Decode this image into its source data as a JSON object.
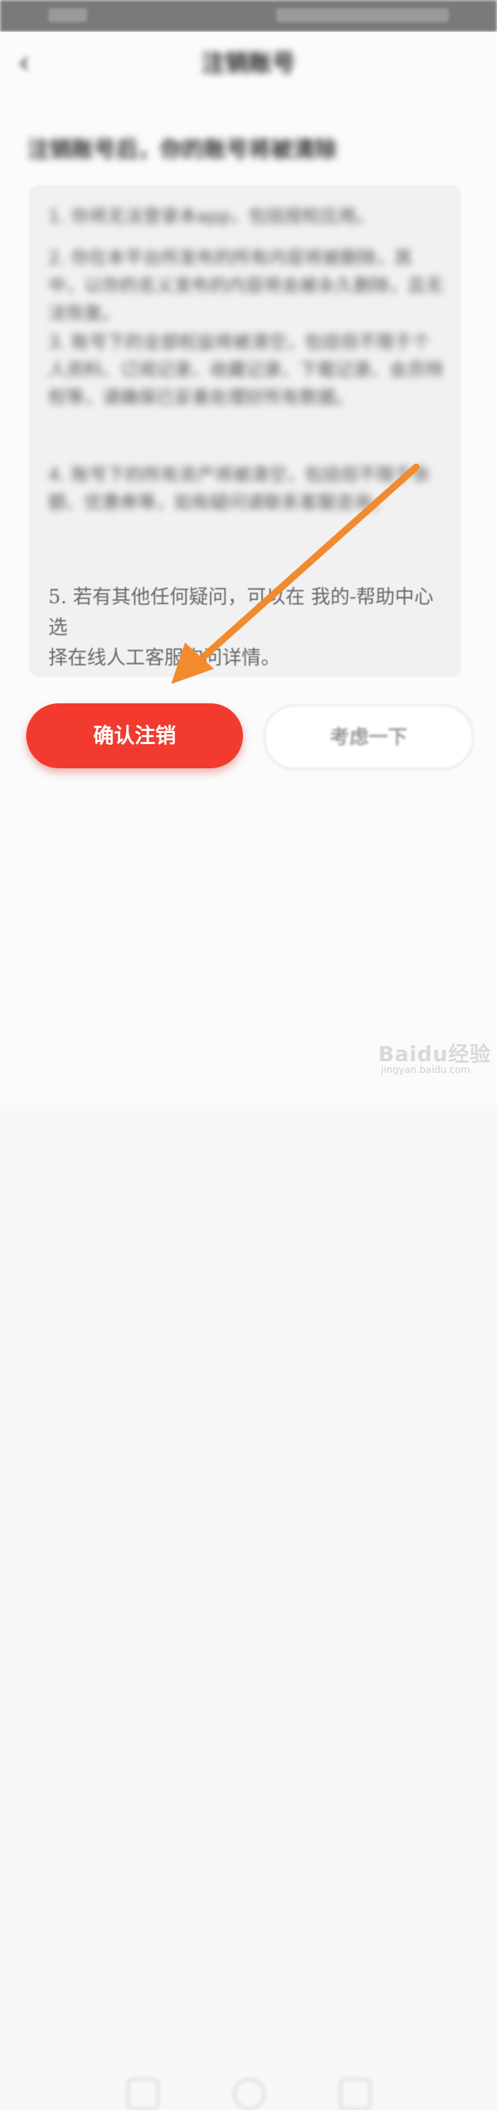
{
  "status_bar": {},
  "header": {
    "back_icon": "chevron-left-icon",
    "title": "注销账号"
  },
  "subtitle": "注销账号后，你的账号将被清除",
  "terms": {
    "item1": "1. 你将无法登录本app，包括授权应用。",
    "item2": "2. 你在本平台所发布的所有内容将被删除，其中，以你的名义发布的内容将会被永久删除，且无法恢复。",
    "item3": "3. 账号下的全部权益将被清空，包括但不限于个人资料、订阅记录、收藏记录、下载记录、会员特权等，请确保已妥善处理好所有数据。",
    "item4": "4. 账号下的所有资产将被清空，包括但不限于余额、优惠券等，如有疑问请联系客服咨询。",
    "item5_line1": "5. 若有其他任何疑问，可以在 我的-帮助中心 选",
    "item5_line2": "择在线人工客服询问详情。"
  },
  "buttons": {
    "confirm": "确认注销",
    "later": "考虑一下"
  },
  "annotation": {
    "color": "#f28a2e"
  },
  "bottom_nav": {
    "icons": [
      "square-icon",
      "circle-icon",
      "back-triangle-icon"
    ]
  },
  "watermark": {
    "brand": "Baidu经验",
    "url": "jingyan.baidu.com"
  }
}
